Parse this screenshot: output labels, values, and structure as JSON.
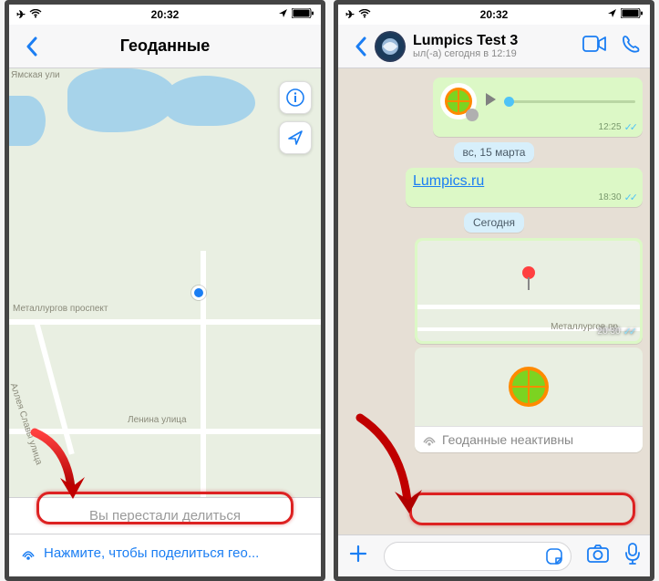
{
  "status": {
    "time": "20:32"
  },
  "left": {
    "title": "Геоданные",
    "roads": {
      "r1": "Металлургов проспект",
      "r2": "Аллея Славы улица",
      "r3": "Ленина улица",
      "r4": "Ямская ули"
    },
    "stopped": "Вы перестали делиться",
    "share": "Нажмите, чтобы поделиться гео..."
  },
  "right": {
    "name": "Lumpics Test 3",
    "sub": "ыл(-а) сегодня в 12:19",
    "voice_time": "12:25",
    "date1": "вс, 15 марта",
    "link": "Lumpics.ru",
    "link_time": "18:30",
    "date2": "Сегодня",
    "map_time": "20:30",
    "map_road": "Металлургов пр",
    "inactive": "Геоданные неактивны"
  }
}
